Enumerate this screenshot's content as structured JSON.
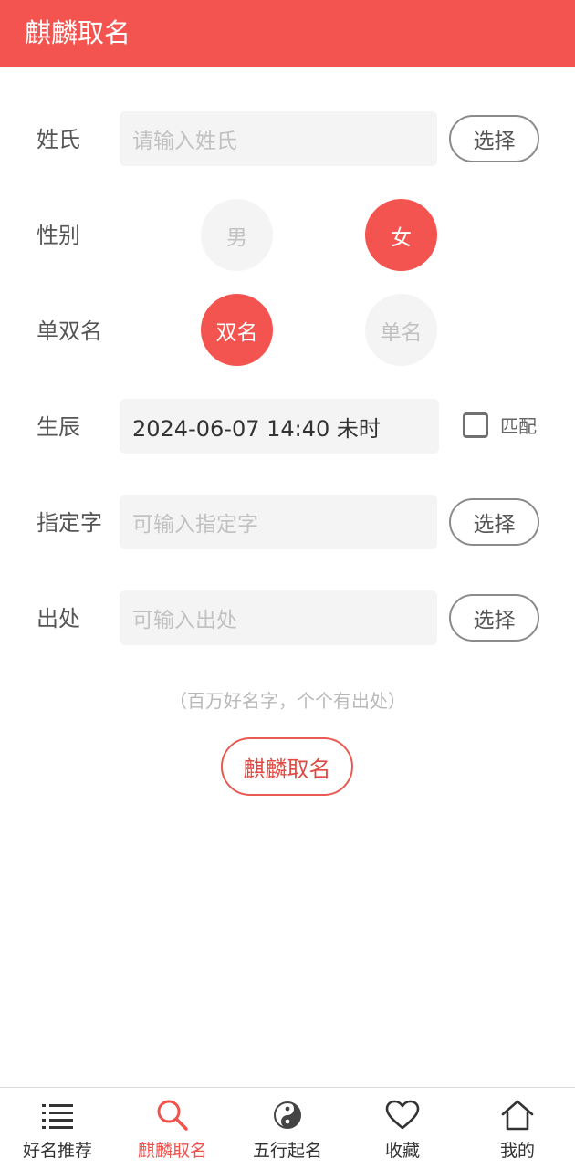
{
  "header": {
    "title": "麒麟取名"
  },
  "form": {
    "surname": {
      "label": "姓氏",
      "placeholder": "请输入姓氏",
      "select_label": "选择"
    },
    "gender": {
      "label": "性别",
      "options": [
        "男",
        "女"
      ],
      "selected": "女"
    },
    "name_length": {
      "label": "单双名",
      "options": [
        "双名",
        "单名"
      ],
      "selected": "双名"
    },
    "birth": {
      "label": "生辰",
      "value": "2024-06-07 14:40 未时",
      "match_label": "匹配",
      "match_checked": false
    },
    "designated_char": {
      "label": "指定字",
      "placeholder": "可输入指定字",
      "select_label": "选择"
    },
    "source": {
      "label": "出处",
      "placeholder": "可输入出处",
      "select_label": "选择"
    }
  },
  "hint": "（百万好名字，个个有出处）",
  "submit_label": "麒麟取名",
  "tabbar": {
    "items": [
      {
        "label": "好名推荐",
        "icon": "list-icon",
        "active": false
      },
      {
        "label": "麒麟取名",
        "icon": "search-icon",
        "active": true
      },
      {
        "label": "五行起名",
        "icon": "yin-yang-icon",
        "active": false
      },
      {
        "label": "收藏",
        "icon": "heart-icon",
        "active": false
      },
      {
        "label": "我的",
        "icon": "home-icon",
        "active": false
      }
    ]
  },
  "colors": {
    "accent": "#f4544f",
    "placeholder": "#c2c2c2",
    "field_bg": "#f4f4f4"
  }
}
